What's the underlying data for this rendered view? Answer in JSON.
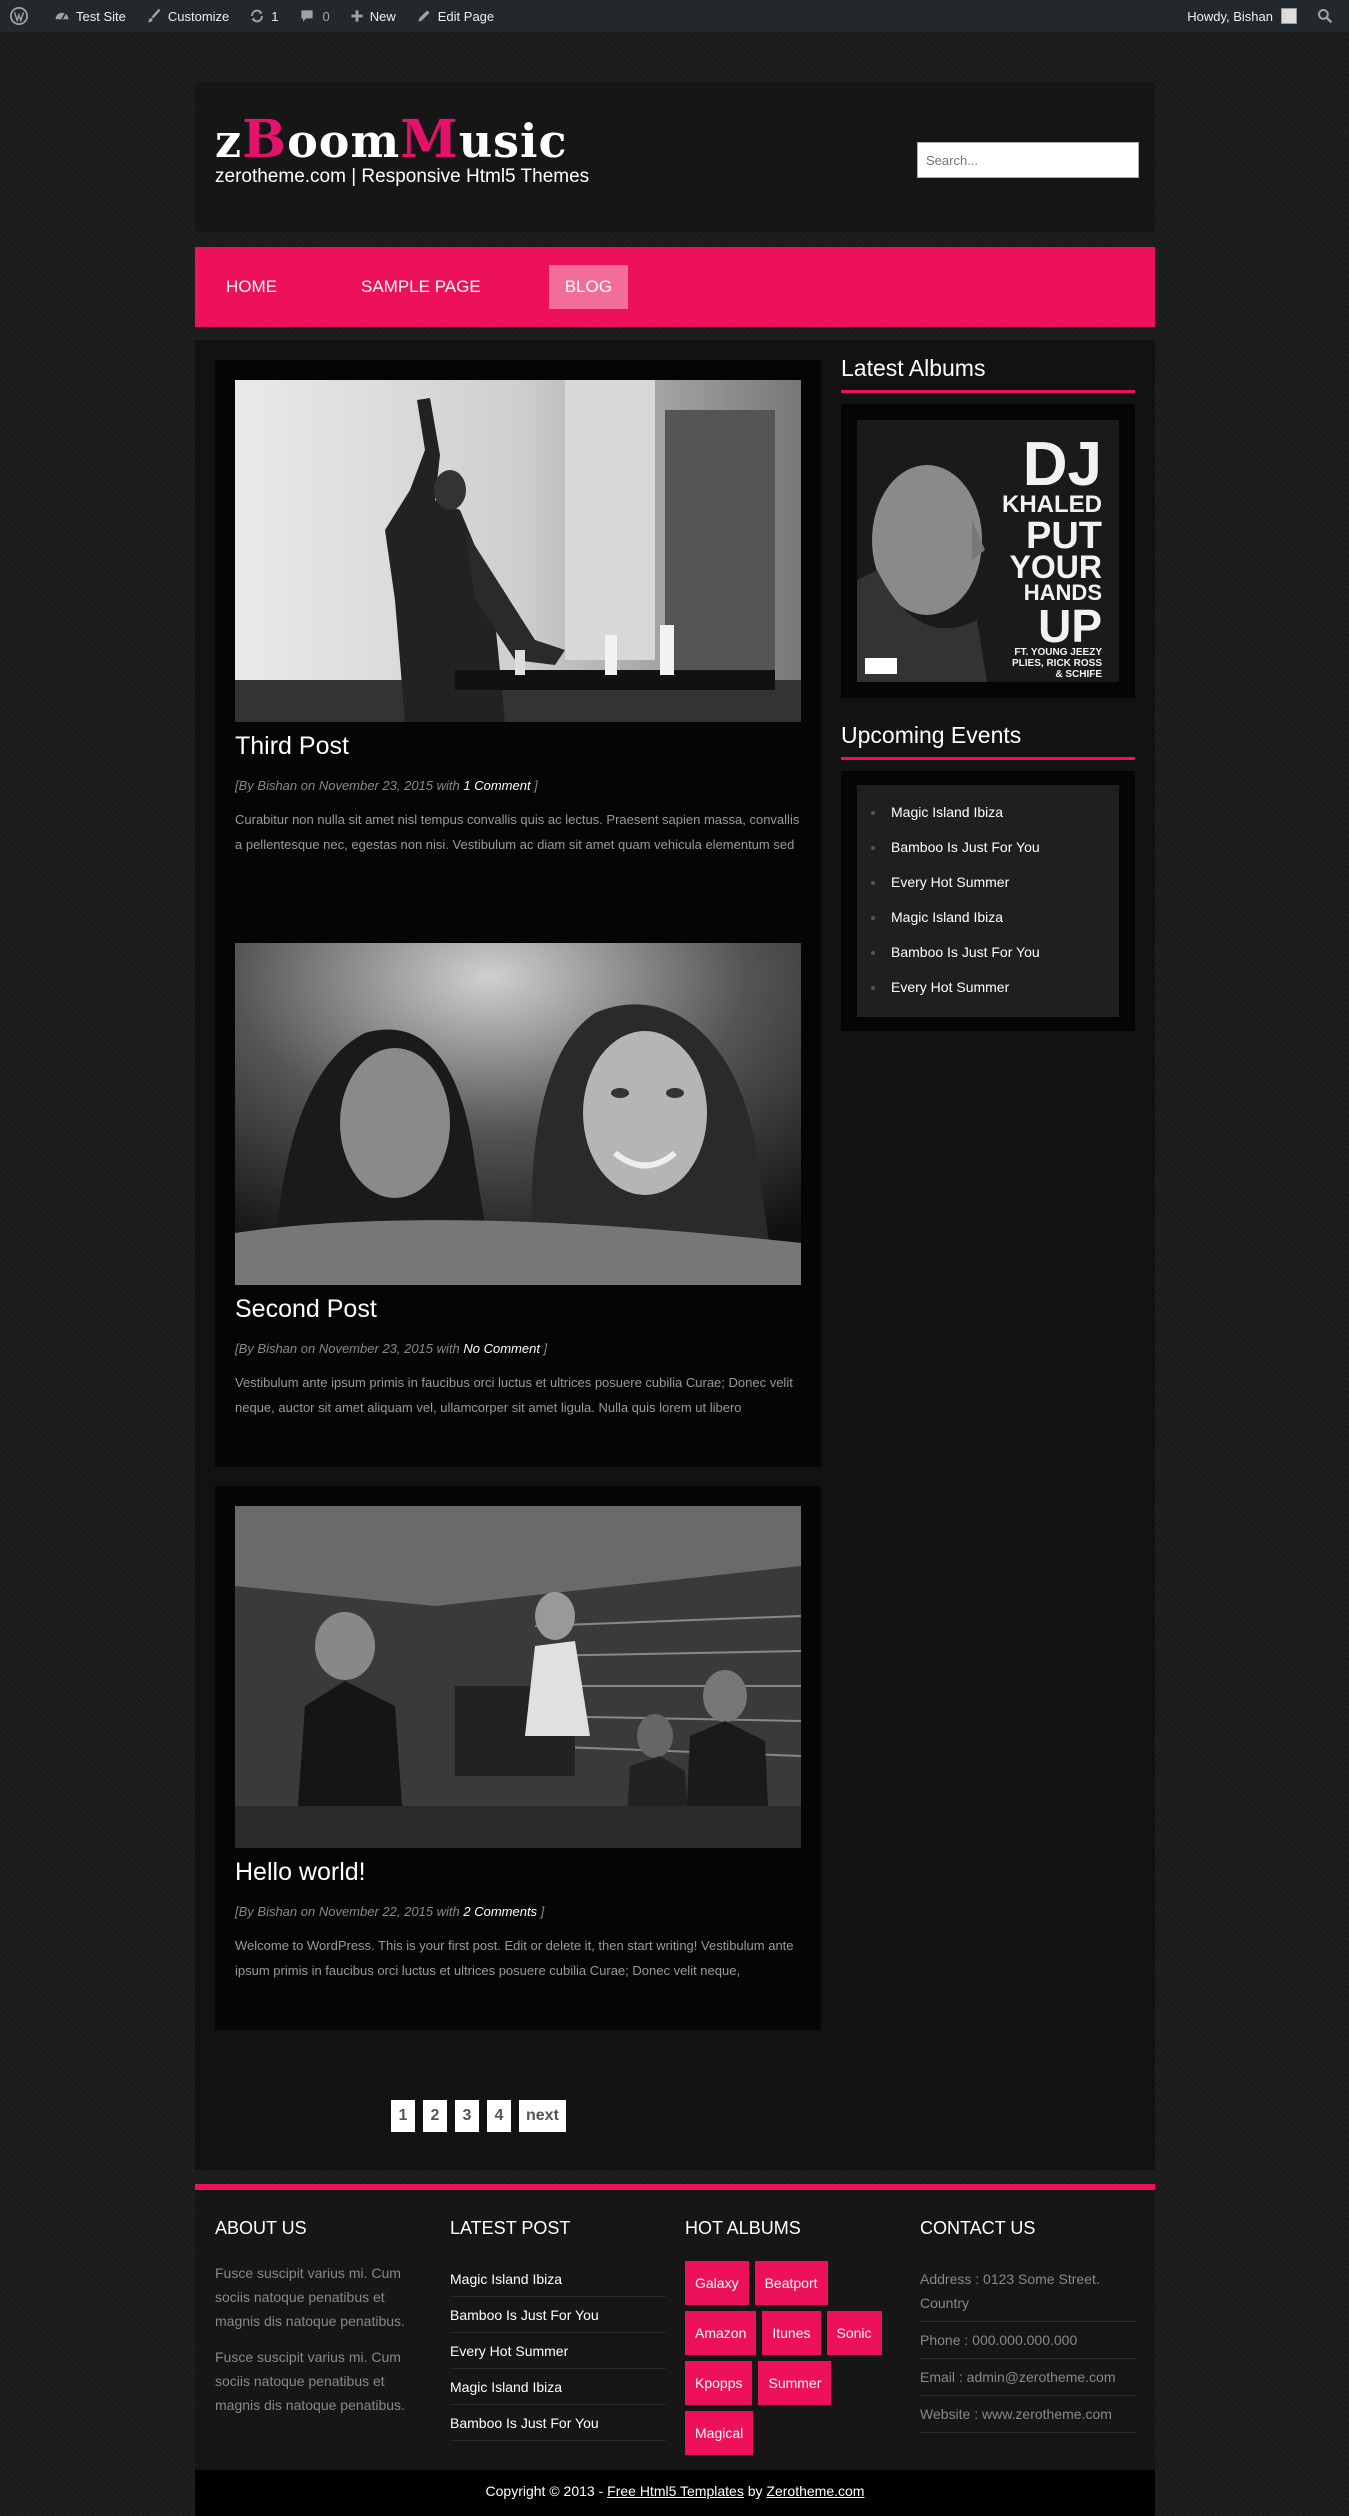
{
  "adminbar": {
    "site": "Test Site",
    "customize": "Customize",
    "updates": "1",
    "comments": "0",
    "new": "New",
    "edit": "Edit Page",
    "howdy": "Howdy, Bishan"
  },
  "header": {
    "logo_parts": [
      "z",
      "B",
      "oom",
      "M",
      "usic"
    ],
    "tagline": "zerotheme.com | Responsive Html5 Themes",
    "search_placeholder": "Search..."
  },
  "nav": {
    "items": [
      {
        "label": "HOME"
      },
      {
        "label": "SAMPLE PAGE"
      },
      {
        "label": "BLOG"
      }
    ]
  },
  "posts": [
    {
      "title": "Third Post",
      "meta_prefix": "[By Bishan on November 23, 2015 with ",
      "comments": "1 Comment",
      "meta_suffix": " ]",
      "excerpt": "Curabitur non nulla sit amet nisl tempus convallis quis ac lectus. Praesent sapien massa, convallis a pellentesque nec, egestas non nisi. Vestibulum ac diam sit amet quam vehicula elementum sed"
    },
    {
      "title": "Second Post",
      "meta_prefix": "[By Bishan on November 23, 2015 with ",
      "comments": "No Comment",
      "meta_suffix": " ]",
      "excerpt": "Vestibulum ante ipsum primis in faucibus orci luctus et ultrices posuere cubilia Curae; Donec velit neque, auctor sit amet aliquam vel, ullamcorper sit amet ligula. Nulla quis lorem ut libero"
    },
    {
      "title": "Hello world!",
      "meta_prefix": "[By Bishan on November 22, 2015 with ",
      "comments": "2 Comments",
      "meta_suffix": " ]",
      "excerpt": "Welcome to WordPress. This is your first post. Edit or delete it, then start writing! Vestibulum ante ipsum primis in faucibus orci luctus et ultrices posuere cubilia Curae; Donec velit neque,"
    }
  ],
  "sidebar": {
    "albums_title": "Latest Albums",
    "album_cover": {
      "line1": "DJ",
      "line2": "KHALED",
      "line3": "PUT",
      "line4": "YOUR",
      "line5": "HANDS",
      "line6": "UP",
      "credits1": "FT. YOUNG JEEZY",
      "credits2": "PLIES, RICK ROSS",
      "credits3": "& SCHIFE"
    },
    "events_title": "Upcoming Events",
    "events": [
      "Magic Island Ibiza",
      "Bamboo Is Just For You",
      "Every Hot Summer",
      "Magic Island Ibiza",
      "Bamboo Is Just For You",
      "Every Hot Summer"
    ]
  },
  "pagination": [
    "1",
    "2",
    "3",
    "4",
    "next"
  ],
  "footer": {
    "about_title": "ABOUT US",
    "about_p1": "Fusce suscipit varius mi. Cum sociis natoque penatibus et magnis dis natoque penatibus.",
    "about_p2": "Fusce suscipit varius mi. Cum sociis natoque penatibus et magnis dis natoque penatibus.",
    "latest_title": "LATEST POST",
    "latest": [
      "Magic Island Ibiza",
      "Bamboo Is Just For You",
      "Every Hot Summer",
      "Magic Island Ibiza",
      "Bamboo Is Just For You"
    ],
    "albums_title": "HOT ALBUMS",
    "tags": [
      "Galaxy",
      "Beatport",
      "Amazon",
      "Itunes",
      "Sonic",
      "Kpopps",
      "Summer",
      "Magical"
    ],
    "contact_title": "CONTACT US",
    "contact": [
      "Address : 0123 Some Street. Country",
      "Phone : 000.000.000.000",
      "Email : admin@zerotheme.com",
      "Website : www.zerotheme.com"
    ]
  },
  "copyright": {
    "prefix": "Copyright © 2013 - ",
    "link1": "Free Html5 Templates",
    "mid": " by ",
    "link2": "Zerotheme.com"
  },
  "colors": {
    "accent": "#ec1159",
    "nav_active": "#f26d98",
    "background": "#1d1d1d"
  }
}
